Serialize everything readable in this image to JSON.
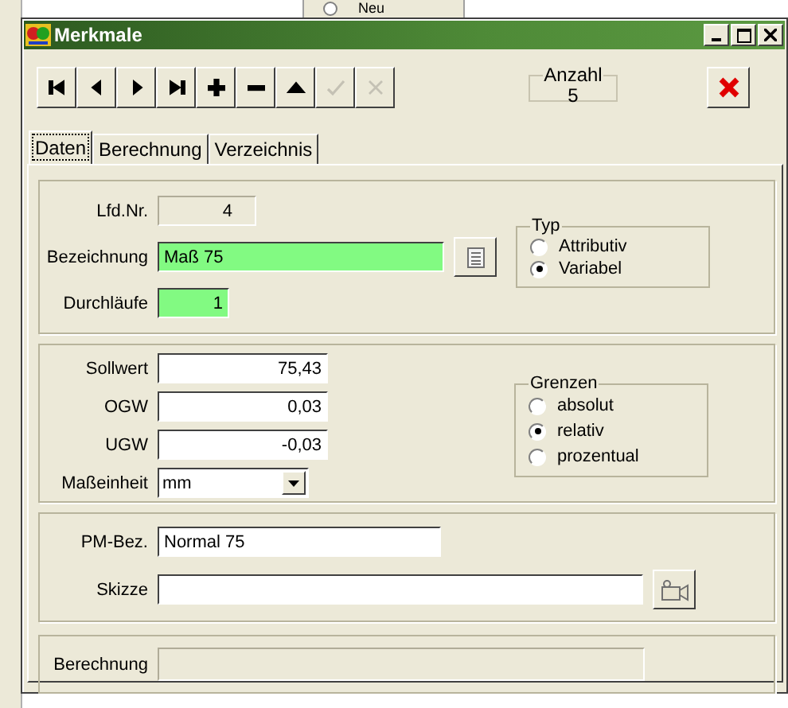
{
  "background_window": {
    "radio_label": "Neu",
    "radio_selected": false
  },
  "window": {
    "title": "Merkmale"
  },
  "toolbar": {
    "buttons": [
      {
        "kind": "first",
        "disabled": false
      },
      {
        "kind": "previous",
        "disabled": false
      },
      {
        "kind": "next",
        "disabled": false
      },
      {
        "kind": "last",
        "disabled": false
      },
      {
        "kind": "add",
        "disabled": false
      },
      {
        "kind": "remove",
        "disabled": false
      },
      {
        "kind": "up",
        "disabled": false
      },
      {
        "kind": "confirm",
        "disabled": true
      },
      {
        "kind": "cancel",
        "disabled": true
      }
    ],
    "count": {
      "label": "Anzahl",
      "value": "5"
    }
  },
  "tabs": [
    {
      "label": "Daten",
      "selected": true
    },
    {
      "label": "Berechnung",
      "selected": false
    },
    {
      "label": "Verzeichnis",
      "selected": false
    }
  ],
  "general": {
    "fields": [
      {
        "label": "Lfd.Nr.",
        "value": "4",
        "kind": "readonly"
      },
      {
        "label": "Bezeichnung",
        "value": "Maß 75",
        "kind": "highlight"
      },
      {
        "label": "Durchläufe",
        "value": "1",
        "kind": "highlight"
      }
    ],
    "typ": {
      "title": "Typ",
      "options": [
        {
          "label": "Attributiv",
          "selected": false
        },
        {
          "label": "Variabel",
          "selected": true
        }
      ]
    }
  },
  "limits": {
    "fields": [
      {
        "label": "Sollwert",
        "value": "75,43",
        "kind": "number"
      },
      {
        "label": "OGW",
        "value": "0,03",
        "kind": "number"
      },
      {
        "label": "UGW",
        "value": "-0,03",
        "kind": "number"
      },
      {
        "label": "Maßeinheit",
        "value": "mm",
        "kind": "dropdown"
      }
    ],
    "grenzen": {
      "title": "Grenzen",
      "options": [
        {
          "label": "absolut",
          "selected": false
        },
        {
          "label": "relativ",
          "selected": true
        },
        {
          "label": "prozentual",
          "selected": false
        }
      ]
    }
  },
  "extra": {
    "fields": [
      {
        "label": "PM-Bez.",
        "value": "Normal 75",
        "kind": "text"
      },
      {
        "label": "Skizze",
        "kind": "file"
      }
    ]
  },
  "calculation": {
    "label": "Berechnung",
    "kind": "readonly"
  }
}
